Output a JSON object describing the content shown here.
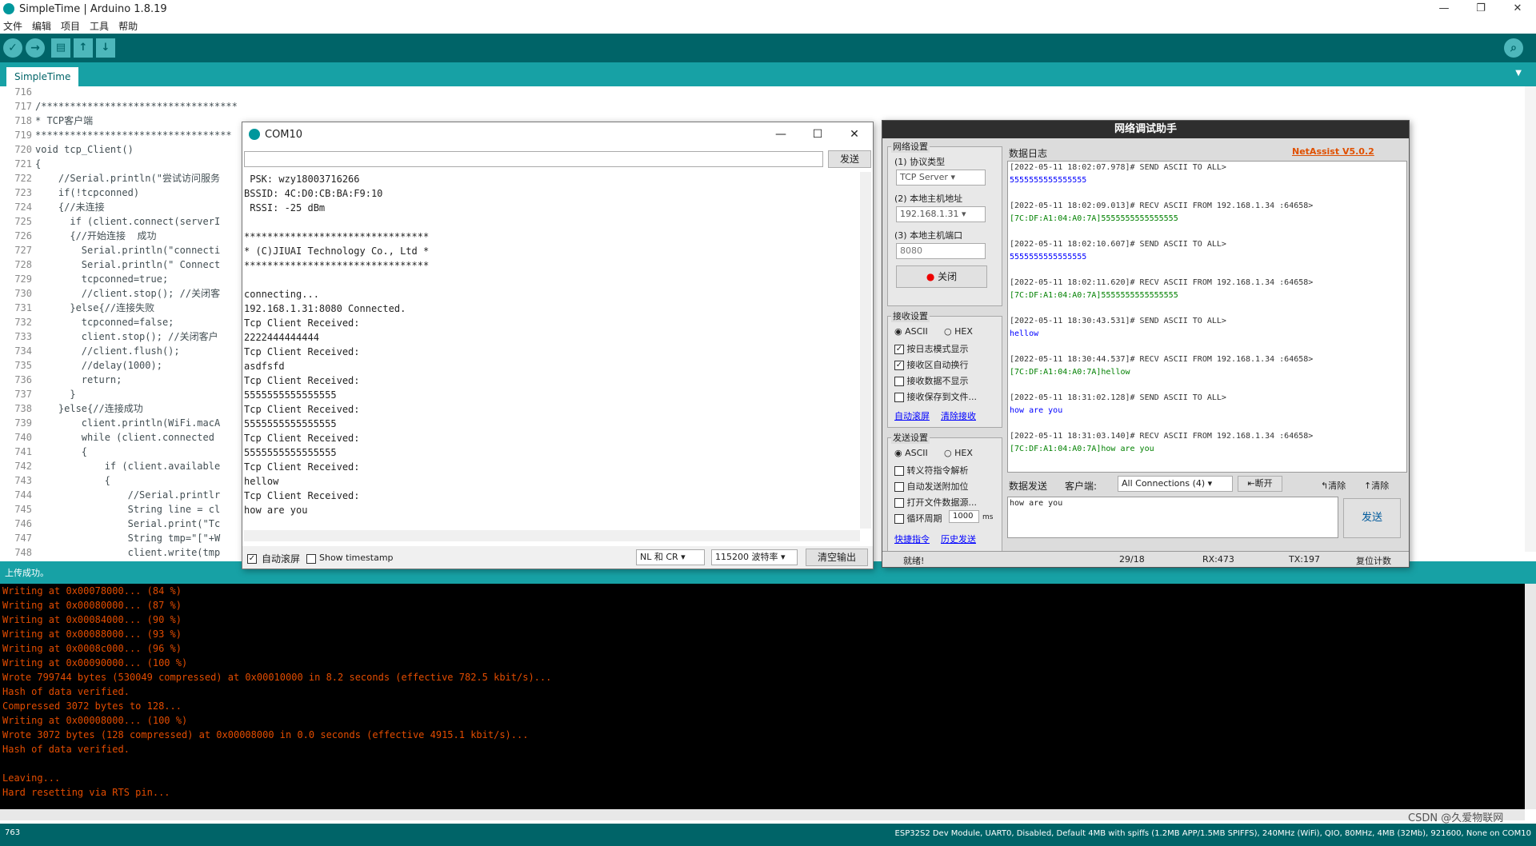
{
  "window": {
    "title": "SimpleTime | Arduino 1.8.19",
    "controls": [
      "—",
      "❐",
      "✕"
    ]
  },
  "menu": [
    "文件",
    "编辑",
    "项目",
    "工具",
    "帮助"
  ],
  "toolbar": {
    "verify": "✓",
    "upload": "→",
    "new": "▤",
    "open": "↑",
    "save": "↓",
    "serial": "⌕"
  },
  "tab": {
    "label": "SimpleTime"
  },
  "editor": {
    "lines": [
      {
        "n": "716",
        "t": ""
      },
      {
        "n": "717",
        "t": "/**********************************"
      },
      {
        "n": "718",
        "t": "* TCP客户端"
      },
      {
        "n": "719",
        "t": "**********************************"
      },
      {
        "n": "720",
        "t": "void tcp_Client()"
      },
      {
        "n": "721",
        "t": "{"
      },
      {
        "n": "722",
        "t": "    //Serial.println(\"尝试访问服务"
      },
      {
        "n": "723",
        "t": "    if(!tcpconned)"
      },
      {
        "n": "724",
        "t": "    {//未连接"
      },
      {
        "n": "725",
        "t": "      if (client.connect(serverI"
      },
      {
        "n": "726",
        "t": "      {//开始连接  成功"
      },
      {
        "n": "727",
        "t": "        Serial.println(\"connecti"
      },
      {
        "n": "728",
        "t": "        Serial.println(\" Connect"
      },
      {
        "n": "729",
        "t": "        tcpconned=true;"
      },
      {
        "n": "730",
        "t": "        //client.stop(); //关闭客"
      },
      {
        "n": "731",
        "t": "      }else{//连接失败"
      },
      {
        "n": "732",
        "t": "        tcpconned=false;"
      },
      {
        "n": "733",
        "t": "        client.stop(); //关闭客户"
      },
      {
        "n": "734",
        "t": "        //client.flush();"
      },
      {
        "n": "735",
        "t": "        //delay(1000);"
      },
      {
        "n": "736",
        "t": "        return;"
      },
      {
        "n": "737",
        "t": "      }"
      },
      {
        "n": "738",
        "t": "    }else{//连接成功"
      },
      {
        "n": "739",
        "t": "        client.println(WiFi.macA"
      },
      {
        "n": "740",
        "t": "        while (client.connected"
      },
      {
        "n": "741",
        "t": "        {"
      },
      {
        "n": "742",
        "t": "            if (client.available"
      },
      {
        "n": "743",
        "t": "            {"
      },
      {
        "n": "744",
        "t": "                //Serial.printlr"
      },
      {
        "n": "745",
        "t": "                String line = cl"
      },
      {
        "n": "746",
        "t": "                Serial.print(\"Tc"
      },
      {
        "n": "747",
        "t": "                String tmp=\"[\"+W"
      },
      {
        "n": "748",
        "t": "                client.write(tmp"
      }
    ]
  },
  "status": {
    "text": "上传成功。"
  },
  "console": {
    "lines": [
      "Writing at 0x00078000... (84 %)",
      "Writing at 0x00080000... (87 %)",
      "Writing at 0x00084000... (90 %)",
      "Writing at 0x00088000... (93 %)",
      "Writing at 0x0008c000... (96 %)",
      "Writing at 0x00090000... (100 %)",
      "Wrote 799744 bytes (530049 compressed) at 0x00010000 in 8.2 seconds (effective 782.5 kbit/s)...",
      "Hash of data verified.",
      "Compressed 3072 bytes to 128...",
      "Writing at 0x00008000... (100 %)",
      "Wrote 3072 bytes (128 compressed) at 0x00008000 in 0.0 seconds (effective 4915.1 kbit/s)...",
      "Hash of data verified.",
      "",
      "Leaving...",
      "Hard resetting via RTS pin..."
    ]
  },
  "bottom": {
    "line_number": "763",
    "board": "ESP32S2 Dev Module, UART0, Disabled, Default 4MB with spiffs (1.2MB APP/1.5MB SPIFFS), 240MHz (WiFi), QIO, 80MHz, 4MB (32Mb), 921600, None on COM10"
  },
  "com10": {
    "title": "COM10",
    "send_label": "发送",
    "output": [
      " PSK: wzy18003716266",
      "BSSID: 4C:D0:CB:BA:F9:10",
      " RSSI: -25 dBm",
      "",
      "********************************",
      "* (C)JIUAI Technology Co., Ltd *",
      "********************************",
      "",
      "connecting...",
      "192.168.1.31:8080 Connected.",
      "Tcp Client Received:",
      "2222444444444",
      "Tcp Client Received:",
      "asdfsfd",
      "Tcp Client Received:",
      "5555555555555555",
      "Tcp Client Received:",
      "5555555555555555",
      "Tcp Client Received:",
      "5555555555555555",
      "Tcp Client Received:",
      "hellow",
      "Tcp Client Received:",
      "how are you"
    ],
    "autoscroll_label": "自动滚屏",
    "timestamp_label": "Show timestamp",
    "line_ending": "NL 和 CR",
    "baud": "115200 波特率",
    "clear_label": "清空输出"
  },
  "netassist": {
    "title": "网络调试助手",
    "brand": "NetAssist V5.0.2",
    "net_settings": "网络设置",
    "protocol_label": "(1) 协议类型",
    "protocol_value": "TCP Server",
    "host_label": "(2) 本地主机地址",
    "host_value": "192.168.1.31",
    "port_label": "(3) 本地主机端口",
    "port_value": "8080",
    "close_label": "关闭",
    "recv_settings": "接收设置",
    "ascii": "ASCII",
    "hex": "HEX",
    "recv_opts": [
      "按日志模式显示",
      "接收区自动换行",
      "接收数据不显示",
      "接收保存到文件..."
    ],
    "recv_checked": [
      true,
      true,
      false,
      false
    ],
    "auto_scroll": "自动滚屏",
    "clear_recv": "清除接收",
    "send_settings": "发送设置",
    "send_opts": [
      "转义符指令解析",
      "自动发送附加位",
      "打开文件数据源...",
      "循环周期"
    ],
    "cycle_value": "1000",
    "cycle_unit": "ms",
    "shortcut": "快捷指令",
    "history": "历史发送",
    "log_tab": "数据日志",
    "log": [
      {
        "k": "meta",
        "t": "[2022-05-11 18:02:07.978]# SEND ASCII TO ALL>"
      },
      {
        "k": "send",
        "t": "5555555555555555"
      },
      {
        "k": "meta",
        "t": ""
      },
      {
        "k": "meta",
        "t": "[2022-05-11 18:02:09.013]# RECV ASCII FROM 192.168.1.34 :64658>"
      },
      {
        "k": "recv",
        "t": "[7C:DF:A1:04:A0:7A]5555555555555555"
      },
      {
        "k": "meta",
        "t": ""
      },
      {
        "k": "meta",
        "t": "[2022-05-11 18:02:10.607]# SEND ASCII TO ALL>"
      },
      {
        "k": "send",
        "t": "5555555555555555"
      },
      {
        "k": "meta",
        "t": ""
      },
      {
        "k": "meta",
        "t": "[2022-05-11 18:02:11.620]# RECV ASCII FROM 192.168.1.34 :64658>"
      },
      {
        "k": "recv",
        "t": "[7C:DF:A1:04:A0:7A]5555555555555555"
      },
      {
        "k": "meta",
        "t": ""
      },
      {
        "k": "meta",
        "t": "[2022-05-11 18:30:43.531]# SEND ASCII TO ALL>"
      },
      {
        "k": "send",
        "t": "hellow"
      },
      {
        "k": "meta",
        "t": ""
      },
      {
        "k": "meta",
        "t": "[2022-05-11 18:30:44.537]# RECV ASCII FROM 192.168.1.34 :64658>"
      },
      {
        "k": "recv",
        "t": "[7C:DF:A1:04:A0:7A]hellow"
      },
      {
        "k": "meta",
        "t": ""
      },
      {
        "k": "meta",
        "t": "[2022-05-11 18:31:02.128]# SEND ASCII TO ALL>"
      },
      {
        "k": "send",
        "t": "how are you"
      },
      {
        "k": "meta",
        "t": ""
      },
      {
        "k": "meta",
        "t": "[2022-05-11 18:31:03.140]# RECV ASCII FROM 192.168.1.34 :64658>"
      },
      {
        "k": "recv",
        "t": "[7C:DF:A1:04:A0:7A]how are you"
      }
    ],
    "send_tab": "数据发送",
    "client_label": "客户端:",
    "client_value": "All Connections (4)",
    "disconnect": "断开",
    "clear1": "清除",
    "clear2": "清除",
    "send_text": "how are you",
    "send_button": "发送",
    "status_ready": "就绪!",
    "counter": "29/18",
    "rx": "RX:473",
    "tx": "TX:197",
    "reset": "复位计数"
  },
  "watermark": "CSDN @久爱物联网"
}
